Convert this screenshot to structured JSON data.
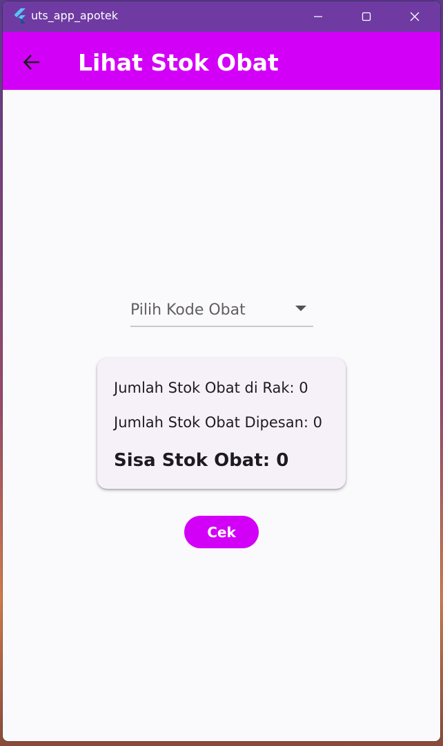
{
  "window": {
    "title": "uts_app_apotek",
    "controls": [
      "minimize-icon",
      "maximize-icon",
      "close-icon"
    ]
  },
  "appbar": {
    "back_icon": "arrow-left-icon",
    "title": "Lihat Stok Obat",
    "color": "#d300f7"
  },
  "form": {
    "dropdown_hint": "Pilih Kode Obat",
    "dropdown_icon": "caret-down-icon"
  },
  "result_card": {
    "stok_rak": "Jumlah Stok Obat di Rak: 0",
    "stok_dipesan": "Jumlah Stok Obat Dipesan: 0",
    "sisa_stok": "Sisa Stok Obat: 0"
  },
  "actions": {
    "cek_label": "Cek"
  },
  "colors": {
    "titlebar": "#6f3ba2",
    "accent": "#d300f7",
    "background": "#faf9fb",
    "card": "#f6f1f8"
  }
}
